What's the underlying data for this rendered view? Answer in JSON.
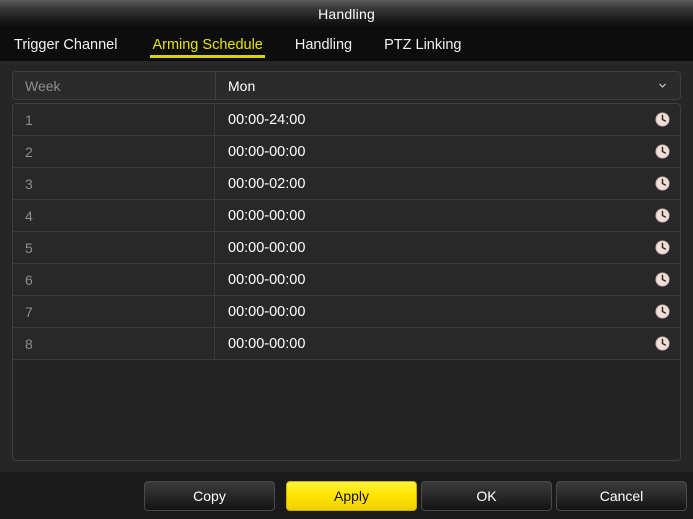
{
  "window": {
    "title": "Handling"
  },
  "tabs": [
    {
      "label": "Trigger Channel",
      "active": false
    },
    {
      "label": "Arming Schedule",
      "active": true
    },
    {
      "label": "Handling",
      "active": false
    },
    {
      "label": "PTZ Linking",
      "active": false
    }
  ],
  "week": {
    "label": "Week",
    "value": "Mon",
    "chevron_icon": "chevron-down-icon"
  },
  "schedule": {
    "row_icon": "clock-icon",
    "rows": [
      {
        "index": "1",
        "time": "00:00-24:00"
      },
      {
        "index": "2",
        "time": "00:00-00:00"
      },
      {
        "index": "3",
        "time": "00:00-02:00"
      },
      {
        "index": "4",
        "time": "00:00-00:00"
      },
      {
        "index": "5",
        "time": "00:00-00:00"
      },
      {
        "index": "6",
        "time": "00:00-00:00"
      },
      {
        "index": "7",
        "time": "00:00-00:00"
      },
      {
        "index": "8",
        "time": "00:00-00:00"
      }
    ]
  },
  "footer": {
    "copy_label": "Copy",
    "apply_label": "Apply",
    "ok_label": "OK",
    "cancel_label": "Cancel"
  },
  "colors": {
    "accent_yellow": "#ffe400",
    "tab_active": "#e8e400",
    "window_bg": "#262626",
    "titlebar_dark": "#0c0c0c",
    "clock_face": "#f0ddd8"
  }
}
